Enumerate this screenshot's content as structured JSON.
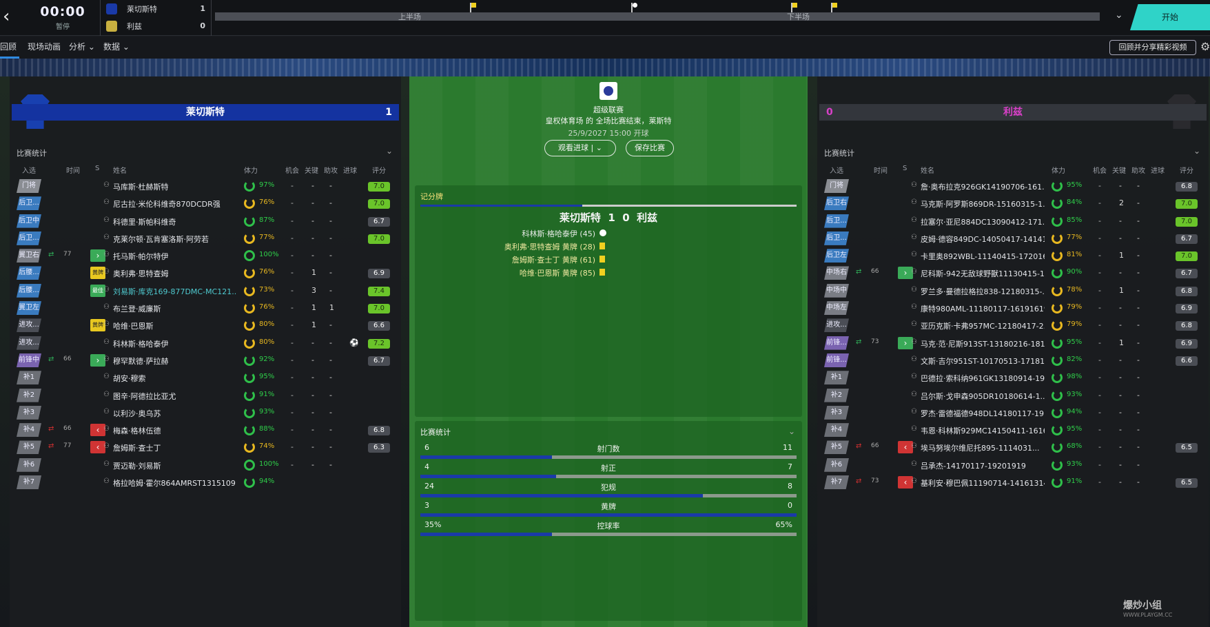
{
  "topbar": {
    "clock": "00:00",
    "clock_status": "暂停",
    "home_team": "莱切斯特",
    "home_goals": "1",
    "away_team": "利兹",
    "away_goals": "0",
    "first_half": "上半场",
    "second_half": "下半场",
    "start_label": "开始",
    "accent": "#2fd3c8"
  },
  "subnav": {
    "tabs": [
      "回顾",
      "现场动画",
      "分析",
      "数据"
    ],
    "replay_label": "回顾并分享精彩视频"
  },
  "left": {
    "team": "莱切斯特",
    "score": "1",
    "stats_title": "比赛统计",
    "headers": [
      "入选",
      "时间",
      "S",
      "姓名",
      "体力",
      "机会",
      "关键",
      "助攻",
      "进球",
      "评分"
    ],
    "players": [
      {
        "pos": "门将",
        "t": "gk",
        "name": "马库斯·杜赫斯特",
        "pct": "97%",
        "c1": "-",
        "c2": "-",
        "c3": "-",
        "rate": "7.0",
        "hi": 1
      },
      {
        "pos": "后卫...",
        "t": "def",
        "name": "尼古拉·米伦科维奇870DCDR强",
        "pct": "76%",
        "o": 1,
        "c1": "-",
        "c2": "-",
        "c3": "-",
        "rate": "7.0",
        "hi": 1
      },
      {
        "pos": "后卫中",
        "t": "def",
        "name": "科德里·斯帕科维奇",
        "pct": "87%",
        "c1": "-",
        "c2": "-",
        "c3": "-",
        "rate": "6.7"
      },
      {
        "pos": "后卫...",
        "t": "def",
        "name": "克莱尔顿·瓦肯塞洛斯·阿劳若",
        "pct": "77%",
        "o": 1,
        "c1": "-",
        "c2": "-",
        "c3": "-",
        "rate": "7.0",
        "hi": 1
      },
      {
        "pos": "翼卫右",
        "t": "mid",
        "sub": "in",
        "min": "77",
        "s": "in",
        "name": "托马斯·帕尔特伊",
        "pct": "100%",
        "c1": "-",
        "c2": "-",
        "c3": "-",
        "rate": ""
      },
      {
        "pos": "后腰...",
        "t": "def",
        "s": "yel",
        "slabel": "黄牌",
        "name": "奥利弗·思特查姆",
        "pct": "76%",
        "o": 1,
        "c1": "-",
        "c2": "1",
        "c3": "-",
        "rate": "6.9"
      },
      {
        "pos": "后腰...",
        "t": "def",
        "s": "cap",
        "slabel": "最佳",
        "name": "刘易斯·库克169-877DMC-MC121...",
        "hl": 1,
        "pct": "73%",
        "o": 1,
        "c1": "-",
        "c2": "3",
        "c3": "-",
        "rate": "7.4",
        "hi": 1
      },
      {
        "pos": "翼卫左",
        "t": "def",
        "name": "布兰登·威廉斯",
        "pct": "76%",
        "o": 1,
        "c1": "-",
        "c2": "1",
        "c3": "1",
        "rate": "7.0",
        "hi": 1
      },
      {
        "pos": "进攻...",
        "t": "att",
        "s": "yel",
        "slabel": "黄牌",
        "name": "哈维·巴恩斯",
        "pct": "80%",
        "o": 1,
        "c1": "-",
        "c2": "1",
        "c3": "-",
        "rate": "6.6"
      },
      {
        "pos": "进攻...",
        "t": "att",
        "name": "科林斯·格哈泰伊",
        "pct": "80%",
        "o": 1,
        "c1": "-",
        "c2": "-",
        "c3": "-",
        "goal": "⚽",
        "rate": "7.2",
        "hi": 1
      },
      {
        "pos": "前锋中",
        "t": "fw",
        "sub": "in",
        "min": "66",
        "s": "in",
        "name": "穆罕默德·萨拉赫",
        "pct": "92%",
        "c1": "-",
        "c2": "-",
        "c3": "-",
        "rate": "6.7"
      },
      {
        "pos": "补1",
        "t": "sub",
        "name": "胡安·穆索",
        "pct": "95%",
        "c1": "-",
        "c2": "-",
        "c3": "-",
        "rate": ""
      },
      {
        "pos": "补2",
        "t": "sub",
        "name": "图辛·阿德拉比亚尤",
        "pct": "91%",
        "c1": "-",
        "c2": "-",
        "c3": "-",
        "rate": ""
      },
      {
        "pos": "补3",
        "t": "sub",
        "name": "以利沙·奥乌苏",
        "pct": "93%",
        "c1": "-",
        "c2": "-",
        "c3": "-",
        "rate": ""
      },
      {
        "pos": "补4",
        "t": "sub",
        "sub": "out",
        "min": "66",
        "s": "out",
        "name": "梅森·格林伍德",
        "pct": "88%",
        "c1": "-",
        "c2": "-",
        "c3": "-",
        "rate": "6.8"
      },
      {
        "pos": "补5",
        "t": "sub",
        "sub": "out",
        "min": "77",
        "s": "out",
        "name": "詹姆斯·查士丁",
        "pct": "74%",
        "o": 1,
        "c1": "-",
        "c2": "-",
        "c3": "-",
        "rate": "6.3"
      },
      {
        "pos": "补6",
        "t": "sub",
        "name": "贾迈勒·刘易斯",
        "pct": "100%",
        "c1": "-",
        "c2": "-",
        "c3": "-",
        "rate": ""
      },
      {
        "pos": "补7",
        "t": "sub",
        "name": "格拉哈姆·霍尔864AMRST1315109",
        "pct": "94%",
        "c1": "",
        "c2": "",
        "c3": "",
        "rate": ""
      }
    ]
  },
  "right": {
    "team": "利兹",
    "score": "0",
    "stats_title": "比赛统计",
    "headers": [
      "入选",
      "时间",
      "S",
      "姓名",
      "体力",
      "机会",
      "关键",
      "助攻",
      "进球",
      "评分"
    ],
    "players": [
      {
        "pos": "门将",
        "t": "gk",
        "name": "詹·奥布拉克926GK14190706-161...",
        "pct": "95%",
        "c1": "-",
        "c2": "-",
        "c3": "-",
        "rate": "6.8"
      },
      {
        "pos": "后卫右",
        "t": "def",
        "name": "马克斯·阿罗斯869DR-15160315-1...",
        "pct": "84%",
        "c1": "-",
        "c2": "2",
        "c3": "-",
        "rate": "7.0",
        "hi": 1
      },
      {
        "pos": "后卫...",
        "t": "def",
        "name": "拉塞尔·亚尼884DC13090412-171...",
        "pct": "85%",
        "c1": "-",
        "c2": "-",
        "c3": "-",
        "rate": "7.0",
        "hi": 1
      },
      {
        "pos": "后卫...",
        "t": "def",
        "name": "皮姆·德容849DC-14050417-14141...",
        "pct": "77%",
        "o": 1,
        "c1": "-",
        "c2": "-",
        "c3": "-",
        "rate": "6.7"
      },
      {
        "pos": "后卫左",
        "t": "def",
        "name": "卡里奥892WBL-11140415-17201617",
        "pct": "81%",
        "o": 1,
        "c1": "-",
        "c2": "1",
        "c3": "-",
        "rate": "7.0",
        "hi": 1
      },
      {
        "pos": "中场右",
        "t": "mid",
        "sub": "in",
        "min": "66",
        "s": "in",
        "name": "尼科斯-942无敌球野獸11130415-1...",
        "pct": "90%",
        "c1": "-",
        "c2": "-",
        "c3": "-",
        "rate": "6.7"
      },
      {
        "pos": "中场中",
        "t": "mid",
        "name": "罗兰多·曼德拉格拉838-12180315-...",
        "pct": "78%",
        "o": 1,
        "c1": "-",
        "c2": "1",
        "c3": "-",
        "rate": "6.8"
      },
      {
        "pos": "中场左",
        "t": "mid",
        "name": "康特980AML-11180117-16191619",
        "pct": "79%",
        "o": 1,
        "c1": "-",
        "c2": "-",
        "c3": "-",
        "rate": "6.9"
      },
      {
        "pos": "进攻...",
        "t": "att",
        "name": "亚历克斯·卡弗957MC-12180417-2...",
        "pct": "79%",
        "o": 1,
        "c1": "-",
        "c2": "-",
        "c3": "-",
        "rate": "6.8"
      },
      {
        "pos": "前锋...",
        "t": "fw",
        "sub": "in",
        "min": "73",
        "s": "in",
        "name": "马克·范·尼斯913ST-13180216-181...",
        "pct": "95%",
        "c1": "-",
        "c2": "1",
        "c3": "-",
        "rate": "6.9"
      },
      {
        "pos": "前锋...",
        "t": "fw",
        "name": "文斯·吉尔951ST-10170513-17181819",
        "pct": "82%",
        "c1": "-",
        "c2": "-",
        "c3": "-",
        "rate": "6.6"
      },
      {
        "pos": "补1",
        "t": "sub",
        "name": "巴德拉·索科纳961GK13180914-19...",
        "pct": "98%",
        "c1": "-",
        "c2": "-",
        "c3": "-",
        "rate": ""
      },
      {
        "pos": "补2",
        "t": "sub",
        "name": "吕尔斯·戈申森905DR10180614-1...",
        "pct": "93%",
        "c1": "-",
        "c2": "-",
        "c3": "-",
        "rate": ""
      },
      {
        "pos": "补3",
        "t": "sub",
        "name": "罗杰·雷德福德948DL14180117-19...",
        "pct": "94%",
        "c1": "-",
        "c2": "-",
        "c3": "-",
        "rate": ""
      },
      {
        "pos": "补4",
        "t": "sub",
        "name": "韦恩·科林斯929MC14150411-1616...",
        "pct": "95%",
        "c1": "-",
        "c2": "-",
        "c3": "-",
        "rate": ""
      },
      {
        "pos": "补5",
        "t": "sub",
        "sub": "out",
        "min": "66",
        "s": "out",
        "name": "埃马努埃尔维尼托895-1114031...",
        "pct": "68%",
        "c1": "-",
        "c2": "-",
        "c3": "-",
        "rate": "6.5"
      },
      {
        "pos": "补6",
        "t": "sub",
        "name": "吕承杰-14170117-19201919",
        "pct": "93%",
        "c1": "-",
        "c2": "-",
        "c3": "-",
        "rate": ""
      },
      {
        "pos": "补7",
        "t": "sub",
        "sub": "out",
        "min": "73",
        "s": "out",
        "name": "基利安·穆巴佩11190714-14161314",
        "pct": "91%",
        "c1": "-",
        "c2": "-",
        "c3": "-",
        "rate": "6.5"
      }
    ]
  },
  "center": {
    "league": "超级联赛",
    "line1": "皇权体育场 的 全场比赛结束，莱斯特",
    "date": "25/9/2027 15:00 开球",
    "watch": "观看进球",
    "save": "保存比赛",
    "scoreboard_title": "记分牌",
    "home": "莱切斯特",
    "hs": "1",
    "as": "0",
    "away": "利兹",
    "events": [
      {
        "text": "科林斯·格哈泰伊 (45)",
        "w": 1,
        "ball": 1
      },
      {
        "text": "奥利弗·思特查姆 黄牌 (28)"
      },
      {
        "text": "詹姆斯·查士丁 黄牌 (61)"
      },
      {
        "text": "哈维·巴恩斯 黄牌 (85)"
      }
    ],
    "stats_title": "比赛统计",
    "stats": [
      {
        "l": "6",
        "m": "射门数",
        "r": "11",
        "f": 0.35
      },
      {
        "l": "4",
        "m": "射正",
        "r": "7",
        "f": 0.36
      },
      {
        "l": "24",
        "m": "犯规",
        "r": "8",
        "f": 0.75
      },
      {
        "l": "3",
        "m": "黄牌",
        "r": "0",
        "f": 1.0
      },
      {
        "l": "35%",
        "m": "控球率",
        "r": "65%",
        "f": 0.35
      }
    ]
  },
  "watermark": {
    "name": "爆炒小组",
    "url": "WWW.PLAYGM.CC"
  }
}
